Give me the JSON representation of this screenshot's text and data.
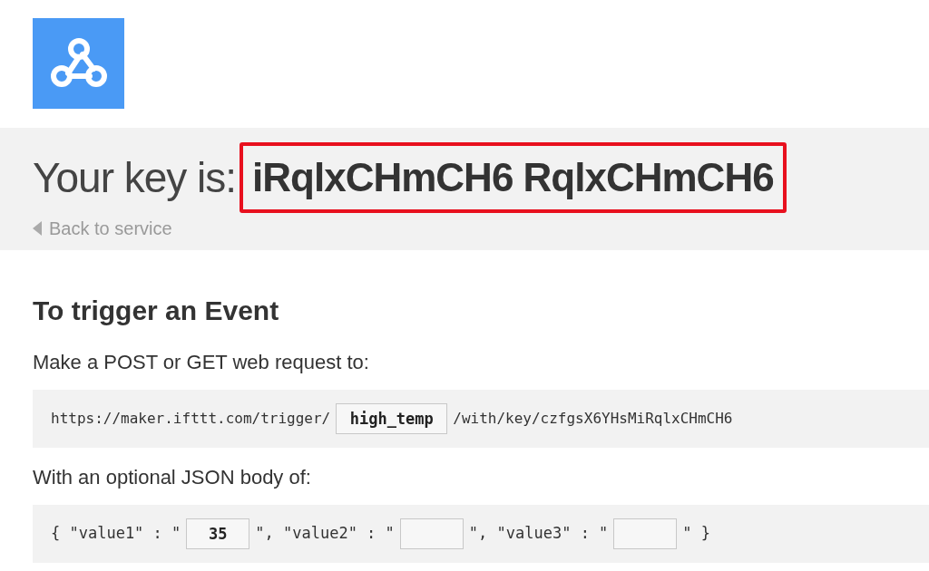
{
  "key_banner": {
    "label": "Your key is:",
    "key": "iRqlxCHmCH6 RqlxCHmCH6",
    "highlighted": true
  },
  "back_link": "Back to service",
  "heading": "To trigger an Event",
  "intro": "Make a POST or GET web request to:",
  "url": [
    {
      "kind": "text",
      "text": "https://maker.ifttt.com/trigger/"
    },
    {
      "kind": "field",
      "value": "high_temp"
    },
    {
      "kind": "text",
      "text": "/with/key/czfgsX6YHsMiRqlxCHmCH6"
    }
  ],
  "body_intro": "With an optional JSON body of:",
  "body": [
    {
      "kind": "text",
      "text": "{ \"value1\" : \""
    },
    {
      "kind": "field",
      "value": "35"
    },
    {
      "kind": "text",
      "text": "\", \"value2\" : \""
    },
    {
      "kind": "field"
    },
    {
      "kind": "text",
      "text": "\", \"value3\" : \""
    },
    {
      "kind": "field"
    },
    {
      "kind": "text",
      "text": "\" }"
    }
  ]
}
